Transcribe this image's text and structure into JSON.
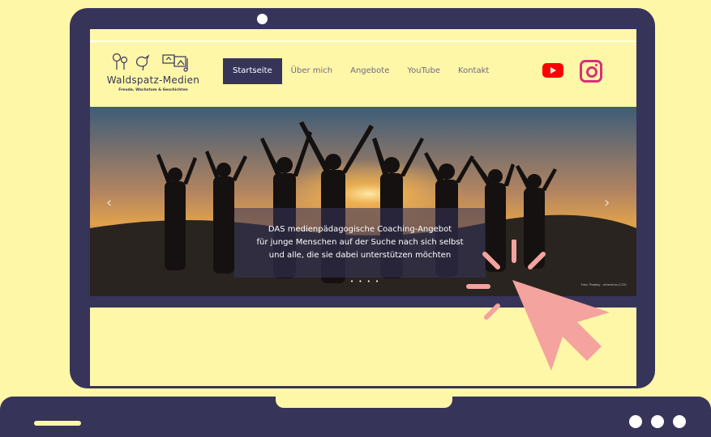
{
  "site": {
    "logo": {
      "title": "Waldspatz-Medien",
      "subtitle": "Freude, Wachstum & Geschichten"
    },
    "nav": [
      {
        "label": "Startseite",
        "active": true
      },
      {
        "label": "Über mich",
        "active": false
      },
      {
        "label": "Angebote",
        "active": false
      },
      {
        "label": "YouTube",
        "active": false
      },
      {
        "label": "Kontakt",
        "active": false
      }
    ],
    "social": {
      "youtube_icon": "youtube-icon",
      "instagram_icon": "instagram-icon"
    },
    "hero": {
      "caption_lines": [
        "DAS medienpädagogische Coaching-Angebot",
        "für junge Menschen auf der Suche nach sich selbst",
        "und alle, die sie dabei unterstützen möchten"
      ],
      "slide_dots": "• • • •",
      "credit": "Foto: Pixabay - mhenritus (CC0)",
      "arrow_left": "‹",
      "arrow_right": "›"
    }
  },
  "colors": {
    "background": "#FFF7A8",
    "laptop": "#37345A",
    "accent_pointer": "#F4A39E",
    "youtube": "#FF0000",
    "instagram": "#D8307A"
  }
}
